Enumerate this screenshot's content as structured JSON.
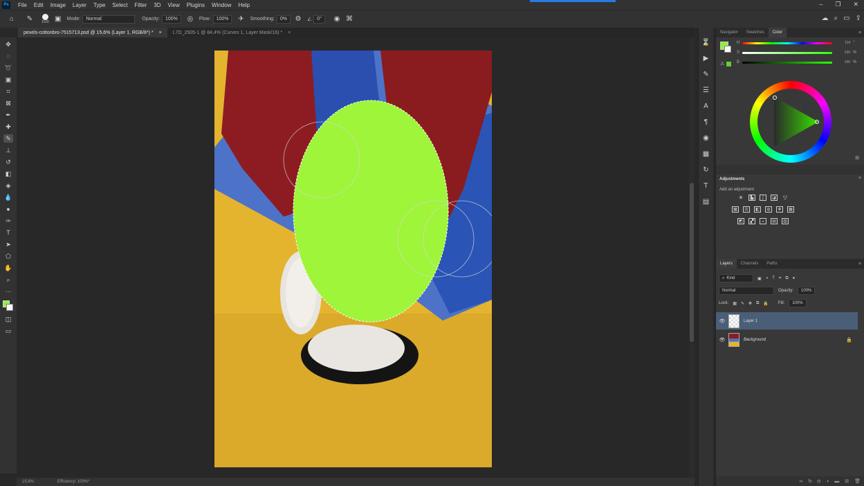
{
  "menubar": {
    "logo": "Ps",
    "items": [
      "File",
      "Edit",
      "Image",
      "Layer",
      "Type",
      "Select",
      "Filter",
      "3D",
      "View",
      "Plugins",
      "Window",
      "Help"
    ],
    "window_controls": [
      "–",
      "❐",
      "✕"
    ]
  },
  "options": {
    "brush_size": "1100",
    "mode_label": "Mode:",
    "mode_value": "Normal",
    "opacity_label": "Opacity:",
    "opacity_value": "100%",
    "flow_label": "Flow:",
    "flow_value": "100%",
    "smoothing_label": "Smoothing:",
    "smoothing_value": "0%",
    "angle_value": "0°"
  },
  "tabs": [
    {
      "label": "pexels-cottonbro-7515713.psd @ 15,6% (Layer 1, RGB/8*) *",
      "close": "×"
    },
    {
      "label": "L7D_2505-1 @ 84,4% (Curves 1, Layer Mask/16) *",
      "close": "×"
    }
  ],
  "status": {
    "zoom": "15,6%",
    "info": "Efficiency: 100%*"
  },
  "colors": {
    "foreground": "#8ef03c",
    "background": "#ffffff",
    "accent": "#2a7be4",
    "fill_green": "#9ef53a",
    "canvas_yellow": "#e4b42f"
  },
  "color_panel": {
    "tabs": [
      "Navigator",
      "Swatches",
      "Color"
    ],
    "active_tab": "Color",
    "sliders": [
      {
        "label": "H",
        "value": "114",
        "unit": "°"
      },
      {
        "label": "S",
        "value": "100",
        "unit": "%"
      },
      {
        "label": "B",
        "value": "100",
        "unit": "%"
      }
    ]
  },
  "adjustments": {
    "title": "Adjustments",
    "subtitle": "Add an adjustment"
  },
  "layers_panel": {
    "tabs": [
      "Layers",
      "Channels",
      "Paths"
    ],
    "active_tab": "Layers",
    "filter_label": "Kind",
    "blend_mode": "Normal",
    "opacity_label": "Opacity:",
    "opacity_value": "100%",
    "lock_label": "Lock:",
    "fill_label": "Fill:",
    "fill_value": "100%",
    "layers": [
      {
        "name": "Layer 1",
        "selected": true
      },
      {
        "name": "Background",
        "selected": false,
        "locked": true
      }
    ]
  }
}
